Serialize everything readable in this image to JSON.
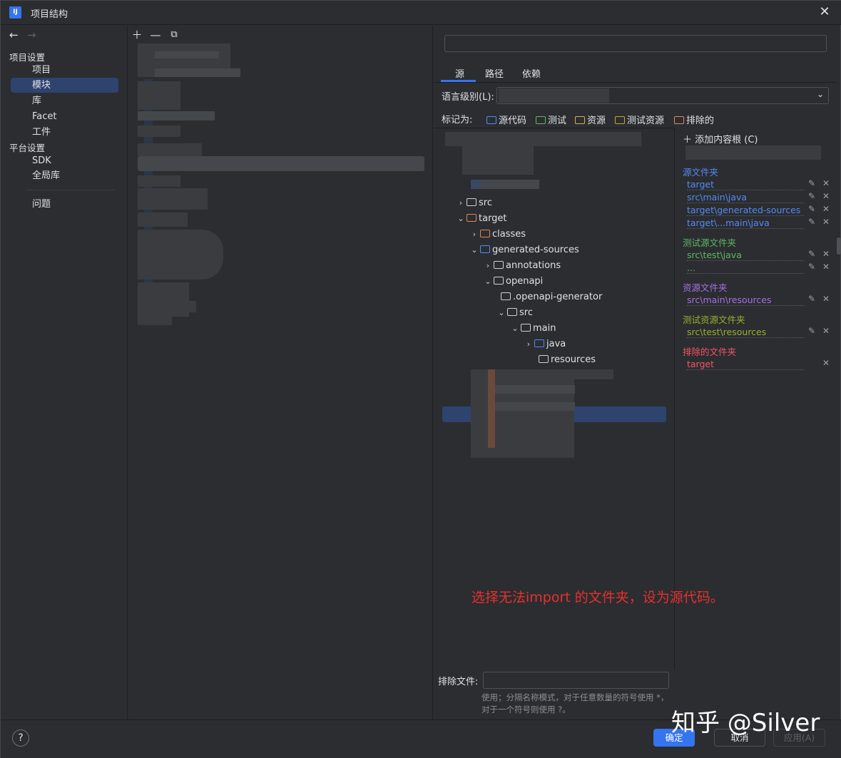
{
  "window": {
    "title": "项目结构",
    "app_icon_text": "IJ",
    "close_icon": "close-icon"
  },
  "nav": {
    "back_icon": "arrow-left-icon",
    "forward_icon": "arrow-right-icon",
    "project_settings_label": "项目设置",
    "items_project": [
      "项目",
      "模块",
      "库",
      "Facet",
      "工件"
    ],
    "platform_settings_label": "平台设置",
    "items_platform": [
      "SDK",
      "全局库"
    ],
    "problems_label": "问题",
    "selected": "模块"
  },
  "modules": {
    "add_icon": "plus-icon",
    "remove_icon": "minus-icon",
    "copy_icon": "copy-icon"
  },
  "tabs": [
    "源",
    "路径",
    "依赖"
  ],
  "active_tab": "源",
  "language_level_label": "语言级别(L):",
  "mark_as_label": "标记为:",
  "mark_buttons": [
    "源代码",
    "测试",
    "资源",
    "测试资源",
    "排除的"
  ],
  "tree": [
    {
      "label": "src",
      "expanded": false
    },
    {
      "label": "target",
      "expanded": true
    },
    {
      "label": "classes",
      "expanded": false
    },
    {
      "label": "generated-sources",
      "expanded": true
    },
    {
      "label": "annotations",
      "expanded": false
    },
    {
      "label": "openapi",
      "expanded": true
    },
    {
      "label": ".openapi-generator",
      "expanded": null
    },
    {
      "label": "src",
      "expanded": true,
      "selected": true
    },
    {
      "label": "main",
      "expanded": true
    },
    {
      "label": "java",
      "expanded": false
    },
    {
      "label": "resources",
      "expanded": null
    }
  ],
  "annotation": "选择无法import 的文件夹，设为源代码。",
  "content_roots": {
    "add_root_label": "添加内容根 (C)",
    "source_folders_title": "源文件夹",
    "source_folders": [
      "target",
      "src\\main\\java",
      "target\\generated-sources",
      "target\\...main\\java"
    ],
    "test_source_title": "测试源文件夹",
    "test_sources": [
      "src\\test\\java",
      "..."
    ],
    "resource_title": "资源文件夹",
    "resources": [
      "src\\main\\resources"
    ],
    "test_resource_title": "测试资源文件夹",
    "test_resources": [
      "src\\test\\resources"
    ],
    "excluded_title": "排除的文件夹",
    "excluded": [
      "target"
    ],
    "colors": {
      "source": "#548af7",
      "test": "#5fb865",
      "resource": "#a571e6",
      "test_resource": "#9aaf2d",
      "excluded": "#f75464"
    }
  },
  "exclude_files": {
    "label": "排除文件:",
    "value": "",
    "hint": "使用；分隔名称模式，对于任意数量的符号使用 *，对于一个符号则使用 ?。"
  },
  "footer": {
    "help_label": "?",
    "ok_label": "确定",
    "cancel_label": "取消",
    "apply_label": "应用(A)"
  },
  "watermark": "知乎 @Silver"
}
